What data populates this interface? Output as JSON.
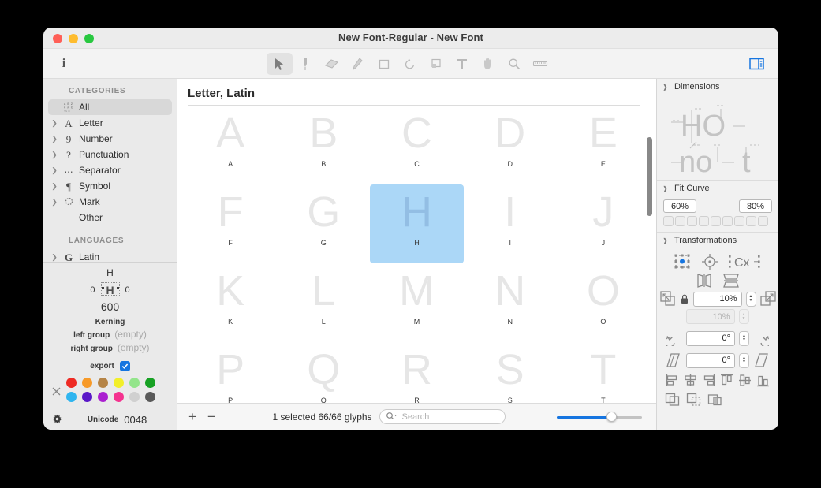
{
  "window": {
    "title": "New Font-Regular - New Font",
    "traffic_lights": [
      "close",
      "minimize",
      "maximize"
    ]
  },
  "toolbar": {
    "info_label": "i",
    "tools": [
      {
        "name": "select-tool",
        "icon": "cursor-icon",
        "active": true
      },
      {
        "name": "pen-tool",
        "icon": "pen-icon",
        "active": false
      },
      {
        "name": "eraser-tool",
        "icon": "eraser-icon",
        "active": false
      },
      {
        "name": "pencil-tool",
        "icon": "pencil-icon",
        "active": false
      },
      {
        "name": "rectangle-tool",
        "icon": "rectangle-icon",
        "active": false
      },
      {
        "name": "rotate-tool",
        "icon": "rotate-icon",
        "active": false
      },
      {
        "name": "shape-tool",
        "icon": "shape-icon",
        "active": false
      },
      {
        "name": "text-tool",
        "icon": "text-icon",
        "active": false
      },
      {
        "name": "hand-tool",
        "icon": "hand-icon",
        "active": false
      },
      {
        "name": "zoom-tool",
        "icon": "magnifier-icon",
        "active": false
      },
      {
        "name": "measure-tool",
        "icon": "ruler-icon",
        "active": false
      }
    ],
    "sidebar_toggle_icon": "sidebar-right-icon",
    "accent_color": "#1675e0"
  },
  "sidebar": {
    "categories_header": "CATEGORIES",
    "categories": [
      {
        "label": "All",
        "icon": "glyph-grid-icon",
        "expandable": false,
        "selected": true
      },
      {
        "label": "Letter",
        "icon": "letter-a-icon",
        "expandable": true,
        "selected": false
      },
      {
        "label": "Number",
        "icon": "digit-nine-icon",
        "expandable": true,
        "selected": false
      },
      {
        "label": "Punctuation",
        "icon": "question-mark-icon",
        "expandable": true,
        "selected": false
      },
      {
        "label": "Separator",
        "icon": "dots-icon",
        "expandable": true,
        "selected": false
      },
      {
        "label": "Symbol",
        "icon": "pilcrow-icon",
        "expandable": true,
        "selected": false
      },
      {
        "label": "Mark",
        "icon": "dotted-circle-icon",
        "expandable": true,
        "selected": false
      },
      {
        "label": "Other",
        "icon": "",
        "expandable": false,
        "selected": false
      }
    ],
    "languages_header": "LANGUAGES",
    "languages": [
      {
        "label": "Latin",
        "icon": "latin-g-icon",
        "expandable": true
      }
    ]
  },
  "glyph_info": {
    "name": "H",
    "left_bearing": "0",
    "right_bearing": "0",
    "preview_glyph": "H",
    "width": "600",
    "kerning_title": "Kerning",
    "left_group_label": "left group",
    "left_group_value": "(empty)",
    "right_group_label": "right group",
    "right_group_value": "(empty)",
    "export_label": "export",
    "export_checked": true,
    "clear_color_icon": "x-icon",
    "swatches": [
      "#ee2b24",
      "#f79a28",
      "#b58447",
      "#f2ef2a",
      "#93e58b",
      "#17a124",
      "#2fb5ef",
      "#5a18c8",
      "#aa1fd0",
      "#f4338f",
      "#d0d0d0",
      "#595959"
    ],
    "gear_icon": "gear-icon",
    "unicode_label": "Unicode",
    "unicode_value": "0048"
  },
  "main": {
    "title": "Letter, Latin",
    "glyphs": [
      {
        "glyph": "A",
        "label": "A",
        "selected": false
      },
      {
        "glyph": "B",
        "label": "B",
        "selected": false
      },
      {
        "glyph": "C",
        "label": "C",
        "selected": false
      },
      {
        "glyph": "D",
        "label": "D",
        "selected": false
      },
      {
        "glyph": "E",
        "label": "E",
        "selected": false
      },
      {
        "glyph": "F",
        "label": "F",
        "selected": false
      },
      {
        "glyph": "G",
        "label": "G",
        "selected": false
      },
      {
        "glyph": "H",
        "label": "H",
        "selected": true
      },
      {
        "glyph": "I",
        "label": "I",
        "selected": false
      },
      {
        "glyph": "J",
        "label": "J",
        "selected": false
      },
      {
        "glyph": "K",
        "label": "K",
        "selected": false
      },
      {
        "glyph": "L",
        "label": "L",
        "selected": false
      },
      {
        "glyph": "M",
        "label": "M",
        "selected": false
      },
      {
        "glyph": "N",
        "label": "N",
        "selected": false
      },
      {
        "glyph": "O",
        "label": "O",
        "selected": false
      },
      {
        "glyph": "P",
        "label": "P",
        "selected": false
      },
      {
        "glyph": "Q",
        "label": "Q",
        "selected": false
      },
      {
        "glyph": "R",
        "label": "R",
        "selected": false
      },
      {
        "glyph": "S",
        "label": "S",
        "selected": false
      },
      {
        "glyph": "T",
        "label": "T",
        "selected": false
      }
    ],
    "selection_color": "#ABD7F7",
    "columns": 5
  },
  "status": {
    "add_label": "+",
    "remove_label": "−",
    "count_text": "1 selected 66/66 glyphs",
    "search_placeholder": "Search",
    "search_value": "",
    "search_icon": "magnifier-dropdown-icon",
    "zoom_percent": 65
  },
  "right_panel": {
    "sections": [
      {
        "title": "Dimensions",
        "collapsed": false
      },
      {
        "title": "Fit Curve",
        "collapsed": false
      },
      {
        "title": "Transformations",
        "collapsed": false
      }
    ],
    "dimensions": {
      "preview_row_1": "HO",
      "preview_row_2": "no t"
    },
    "fit_curve": {
      "field_1": "60%",
      "field_2": "80%",
      "checkbox_count": 9
    },
    "transformations": {
      "icons_row_1": [
        "transform-bbox-icon",
        "transform-origin-icon",
        "transform-metrics-icon"
      ],
      "icons_row_2": [
        "flip-horizontal-icon",
        "flip-vertical-icon"
      ],
      "scale_down_icon": "scale-down-icon",
      "scale_up_icon": "scale-up-icon",
      "lock_icon": "lock-icon",
      "scale_x_value": "10%",
      "scale_y_value": "10%",
      "scale_y_disabled": true,
      "rotate_ccw_icon": "rotate-ccw-icon",
      "rotate_cw_icon": "rotate-cw-icon",
      "rotate_value": "0°",
      "slant_left_icon": "slant-left-icon",
      "slant_right_icon": "slant-right-icon",
      "slant_value": "0°",
      "align_icons": [
        "align-left-icon",
        "align-center-h-icon",
        "align-right-icon",
        "align-top-icon",
        "align-center-v-icon",
        "align-bottom-icon"
      ],
      "boolean_icons": [
        "union-icon",
        "subtract-icon",
        "intersect-icon"
      ]
    }
  }
}
